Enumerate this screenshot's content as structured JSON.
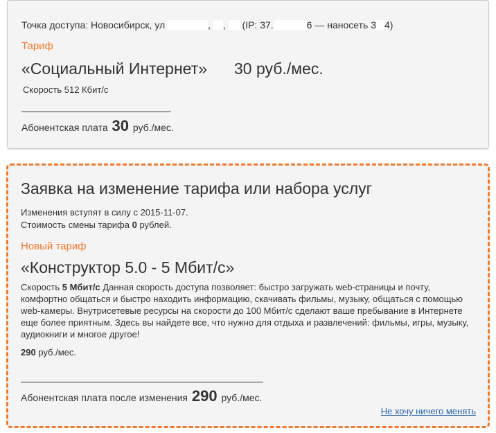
{
  "current": {
    "access_point_prefix": "Точка доступа: Новосибирск, ул",
    "access_point_sep1": ",",
    "access_point_sep2": ",",
    "access_point_ip_prefix": "(IP: 37.",
    "access_point_ip_mid": "6 — наносеть 3",
    "access_point_ip_end": "4)",
    "tariff_label": "Тариф",
    "tariff_name": "«Социальный Интернет»",
    "tariff_price": "30 руб./мес.",
    "speed": "Скорость 512 Кбит/с",
    "fee_label": "Абонентская плата",
    "fee_value": "30",
    "fee_unit": "руб./мес."
  },
  "request": {
    "title": "Заявка на изменение тарифа или набора услуг",
    "effective_prefix": "Изменения вступят в силу с 2015-11-07.",
    "cost_prefix": "Стоимость смены тарифа",
    "cost_value": "0",
    "cost_suffix": "рублей.",
    "new_tariff_label": "Новый тариф",
    "new_tariff_name": "«Конструктор 5.0 - 5 Мбит/с»",
    "desc_prefix": "Скорость",
    "desc_speed": "5 Мбит/с",
    "desc_text": "Данная скорость доступа позволяет: быстро загружать web-страницы и почту, комфортно общаться и быстро находить информацию, скачивать фильмы, музыку, общаться с помощью web-камеры. Внутрисетевые ресурсы на скорости до 100 Мбит/с сделают ваше пребывание в Интернете еще более приятным. Здесь вы найдете все, что нужно для отдыха и развлечений: фильмы, игры, музыку, аудиокниги и многое другое!",
    "price_value": "290",
    "price_unit": "руб./мес.",
    "fee_label": "Абонентская плата после изменения",
    "fee_value": "290",
    "fee_unit": "руб./мес.",
    "no_change_link": "Не хочу ничего менять"
  },
  "colors": {
    "accent": "#ee7a2c",
    "link": "#2a63b0",
    "card_bg": "#f4f4f4"
  }
}
